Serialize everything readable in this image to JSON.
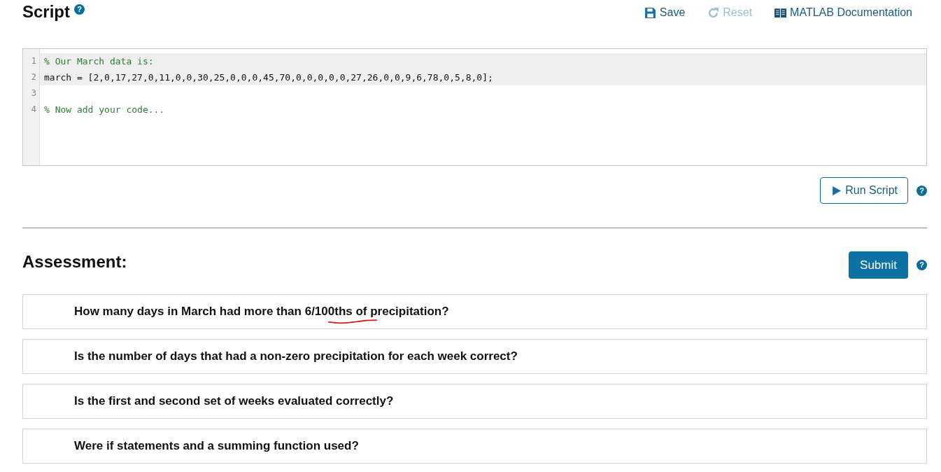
{
  "script": {
    "title": "Script",
    "help": "?",
    "toolbar": [
      {
        "kind": "save",
        "label": "Save",
        "disabled": false
      },
      {
        "kind": "reset",
        "label": "Reset",
        "disabled": true
      },
      {
        "kind": "docs",
        "label": "MATLAB Documentation",
        "disabled": false
      }
    ],
    "editor": {
      "lines": [
        {
          "number": "1",
          "code": "% Our March data is:",
          "kind": "comment",
          "highlighted": true
        },
        {
          "number": "2",
          "code": "march = [2,0,17,27,0,11,0,0,30,25,0,0,0,45,70,0,0,0,0,0,27,26,0,0,9,6,78,0,5,8,0];",
          "kind": "code",
          "highlighted": true
        },
        {
          "number": "3",
          "kind": "blank"
        },
        {
          "number": "4",
          "code": "% Now add your code...",
          "kind": "comment",
          "highlighted": false
        }
      ]
    },
    "run_button": "Run Script",
    "run_help": "?"
  },
  "assessment": {
    "title": "Assessment:",
    "submit_button": "Submit",
    "submit_help": "?",
    "questions": [
      {
        "text": "How many days in March had more than 6/100ths of precipitation?",
        "marked": true
      },
      {
        "text": "Is the number of days that had a non-zero precipitation for each week correct?",
        "marked": false
      },
      {
        "text": "Is the first and second set of weeks evaluated correctly?",
        "marked": false
      },
      {
        "text": "Were if statements and a summing function used?",
        "marked": false
      }
    ]
  }
}
